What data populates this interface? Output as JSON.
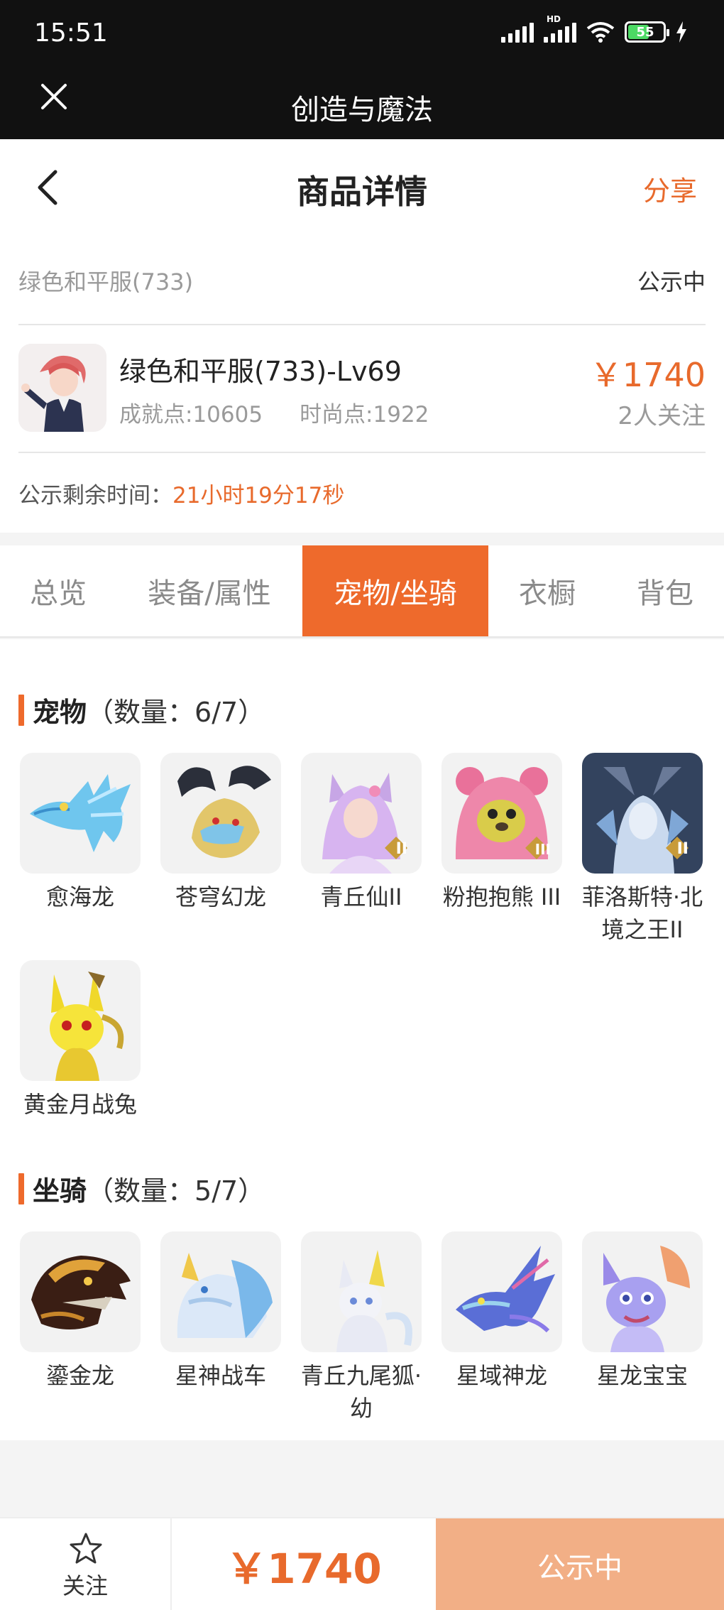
{
  "status_bar": {
    "time": "15:51",
    "battery": "55",
    "hd": "HD"
  },
  "app_bar": {
    "title": "创造与魔法"
  },
  "nav": {
    "title": "商品详情",
    "share": "分享"
  },
  "listing": {
    "server": "绿色和平服(733)",
    "state": "公示中",
    "name": "绿色和平服(733)-Lv69",
    "achievement": "成就点:10605",
    "fashion": "时尚点:1922",
    "price": "￥1740",
    "followers": "2人关注",
    "remaining_label": "公示剩余时间：",
    "remaining_value": "21小时19分17秒"
  },
  "tabs": [
    {
      "label": "总览"
    },
    {
      "label": "装备/属性"
    },
    {
      "label": "宠物/坐骑"
    },
    {
      "label": "衣橱"
    },
    {
      "label": "背包"
    }
  ],
  "active_tab": "宠物/坐骑",
  "pets": {
    "title": "宠物",
    "count": "（数量：6/7）",
    "items": [
      {
        "name": "愈海龙",
        "icon": "blue-sea-dragon-icon"
      },
      {
        "name": "苍穹幻龙",
        "icon": "dark-winged-dragon-icon"
      },
      {
        "name": "青丘仙II",
        "icon": "fox-fairy-icon",
        "badge": "II"
      },
      {
        "name": "粉抱抱熊 III",
        "icon": "pink-bear-icon",
        "badge": "III"
      },
      {
        "name": "菲洛斯特·北境之王II",
        "icon": "frost-king-icon",
        "badge": "II"
      },
      {
        "name": "黄金月战兔",
        "icon": "golden-rabbit-icon"
      }
    ]
  },
  "mounts": {
    "title": "坐骑",
    "count": "（数量：5/7）",
    "items": [
      {
        "name": "鎏金龙",
        "icon": "gilded-dragon-icon"
      },
      {
        "name": "星神战车",
        "icon": "star-chariot-icon"
      },
      {
        "name": "青丘九尾狐·幼",
        "icon": "nine-tailed-fox-icon"
      },
      {
        "name": "星域神龙",
        "icon": "star-dragon-icon"
      },
      {
        "name": "星龙宝宝",
        "icon": "baby-star-dragon-icon"
      }
    ]
  },
  "footer": {
    "follow_label": "关注",
    "price": "￥1740",
    "action": "公示中"
  },
  "colors": {
    "accent": "#ee6a2c",
    "action_button": "#f2af86",
    "bar_background": "#111111"
  }
}
